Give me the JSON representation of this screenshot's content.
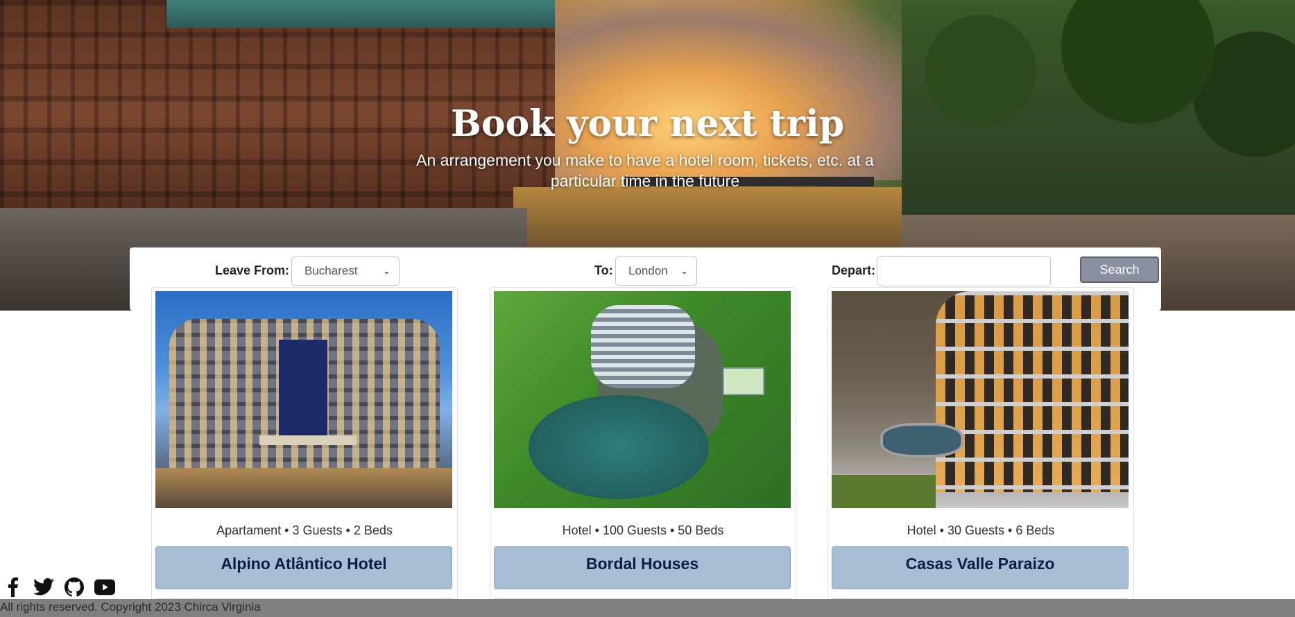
{
  "hero": {
    "title": "Book your next trip",
    "subtitle": "An arrangement you make to have a hotel room, tickets, etc. at a particular time in the future"
  },
  "search": {
    "leave_from_label": "Leave From:",
    "leave_from_value": "Bucharest",
    "to_label": "To:",
    "to_value": "London",
    "depart_label": "Depart:",
    "depart_value": "",
    "search_button": "Search"
  },
  "cards": [
    {
      "meta": "Apartament • 3 Guests • 2 Beds",
      "name": "Alpino Atlântico Hotel"
    },
    {
      "meta": "Hotel • 100 Guests • 50 Beds",
      "name": "Bordal Houses"
    },
    {
      "meta": "Hotel • 30 Guests • 6 Beds",
      "name": "Casas Valle Paraizo"
    }
  ],
  "social": [
    "facebook-icon",
    "twitter-icon",
    "github-icon",
    "youtube-icon"
  ],
  "footer": {
    "copyright": "All rights reserved. Copyright 2023 Chirca Virginia"
  }
}
